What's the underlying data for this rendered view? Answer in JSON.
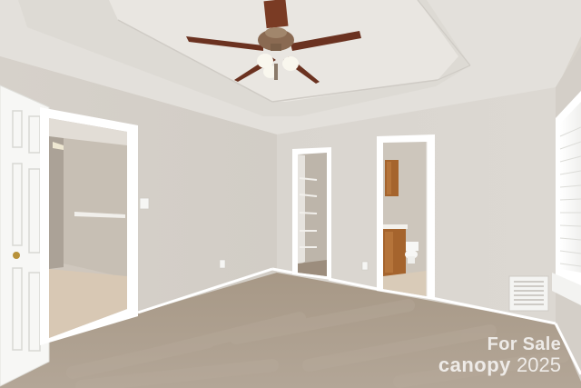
{
  "photo": {
    "subject": "vacant bedroom",
    "colors": {
      "wall": "#d9d4cc",
      "ceiling": "#e4e1dc",
      "trim": "#ffffff",
      "carpet": "#a89a8a",
      "cabinet": "#a5642d",
      "fan_wood": "#7a3b24"
    }
  },
  "watermark": {
    "line1": "For Sale",
    "brand": "canopy",
    "year": "2025"
  }
}
